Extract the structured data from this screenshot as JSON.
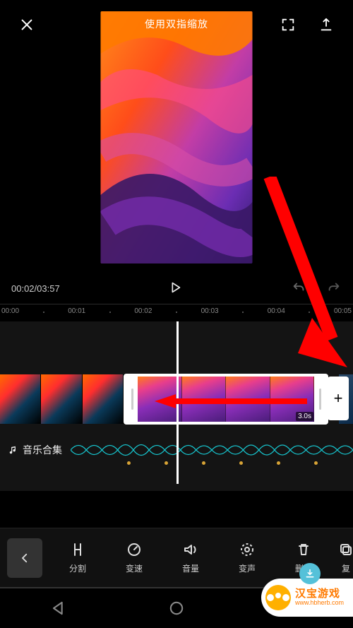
{
  "topbar": {
    "close_icon": "close",
    "fullscreen_icon": "fullscreen",
    "export_icon": "export"
  },
  "preview": {
    "hint": "使用双指缩放"
  },
  "transport": {
    "current_time": "00:02",
    "total_time": "03:57",
    "time_display": "00:02/03:57",
    "play_icon": "play",
    "undo_icon": "undo",
    "redo_icon": "redo"
  },
  "ruler": {
    "ticks": [
      "00:00",
      "00:01",
      "00:02",
      "00:03",
      "00:04",
      "00:05"
    ]
  },
  "timeline": {
    "selected_clip_duration": "3.0s",
    "add_label": "+",
    "audio_track_label": "音乐合集",
    "audio_icon": "music-note"
  },
  "tools": {
    "back_icon": "chevron-left",
    "items": [
      {
        "icon": "split",
        "label": "分割"
      },
      {
        "icon": "speed",
        "label": "变速"
      },
      {
        "icon": "volume",
        "label": "音量"
      },
      {
        "icon": "voice",
        "label": "变声"
      },
      {
        "icon": "delete",
        "label": "删除"
      },
      {
        "icon": "copy",
        "label": "复"
      }
    ]
  },
  "watermark": {
    "title": "汉宝游戏",
    "url": "www.hbherb.com"
  }
}
